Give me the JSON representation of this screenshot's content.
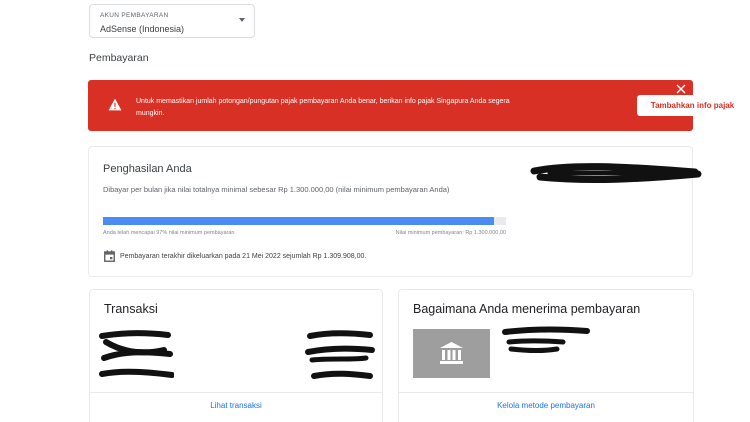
{
  "account": {
    "label": "AKUN PEMBAYARAN",
    "value": "AdSense (Indonesia)"
  },
  "page": {
    "title": "Pembayaran"
  },
  "alert": {
    "message": "Untuk memastikan jumlah potongan/pungutan pajak pembayaran Anda benar, berikan info pajak Singapura Anda segera mungkin.",
    "button_label": "Tambahkan info pajak",
    "color": "#d93025"
  },
  "earnings": {
    "title": "Penghasilan Anda",
    "subtitle": "Dibayar per bulan jika nilai totalnya minimal sebesar Rp 1.300.000,00 (nilai minimum pembayaran Anda)",
    "progress_percent": 97,
    "progress_label_left": "Anda telah mencapai 97% nilai minimum pembayaran",
    "progress_label_right": "Nilai minimum pembayaran: Rp 1.300.000,00",
    "last_payment": "Pembayaran terakhir dikeluarkan pada 21 Mei 2022 sejumlah Rp 1.309.908,00."
  },
  "transactions": {
    "title": "Transaksi",
    "link": "Lihat transaksi"
  },
  "payment_method": {
    "title": "Bagaimana Anda menerima pembayaran",
    "link": "Kelola metode pembayaran"
  },
  "icons": [
    "chevron-down-icon",
    "warning-icon",
    "close-icon",
    "calendar-icon",
    "bank-icon"
  ]
}
